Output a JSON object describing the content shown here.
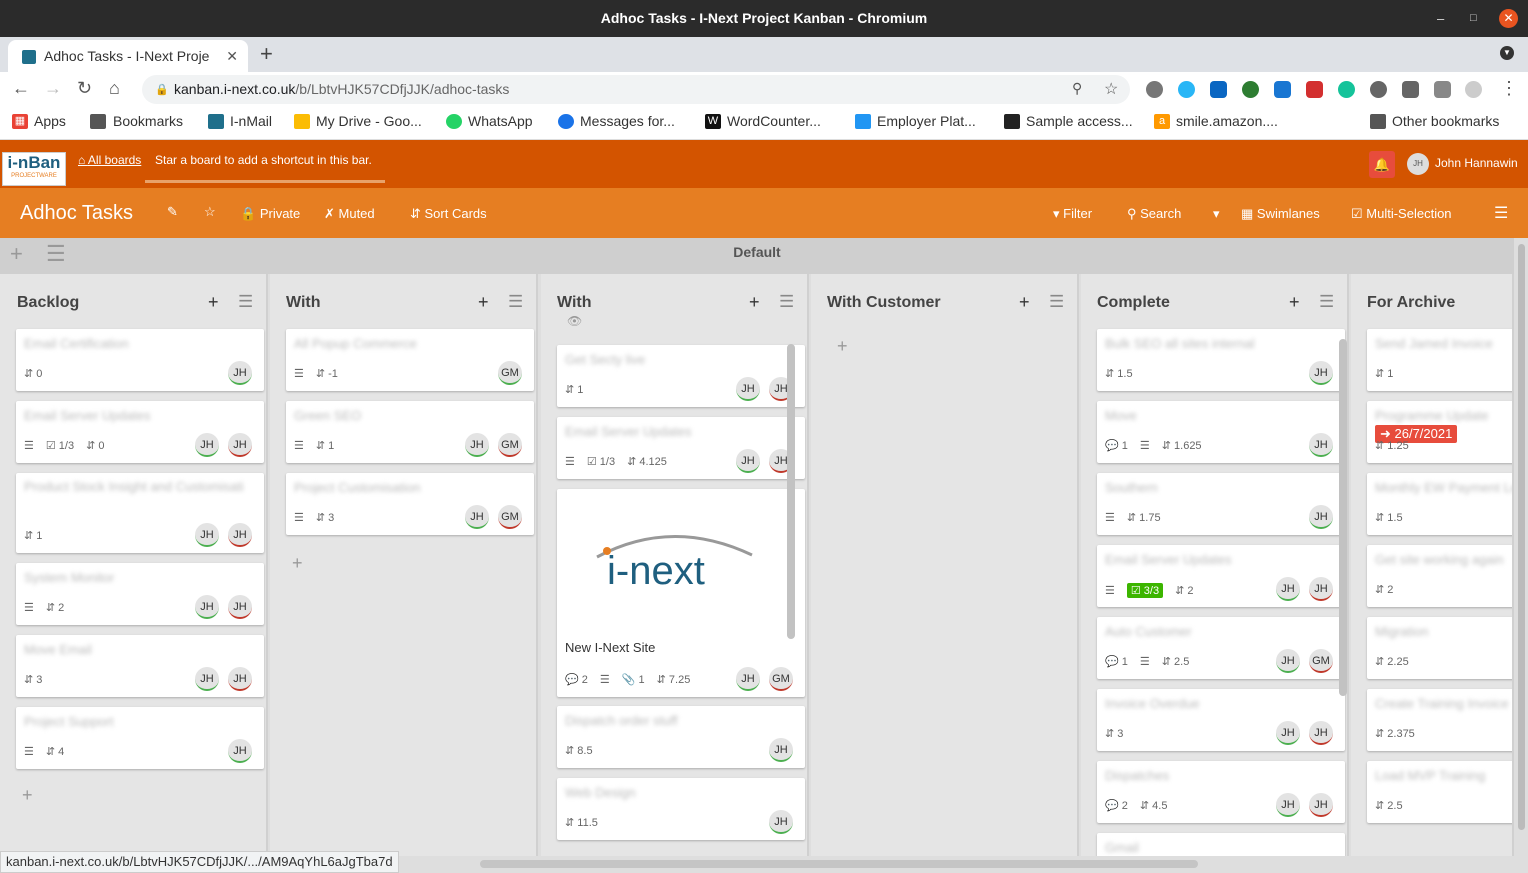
{
  "window": {
    "title": "Adhoc Tasks - I-Next Project Kanban - Chromium"
  },
  "browser": {
    "tab_title": "Adhoc Tasks - I-Next Proje",
    "url_host": "kanban.i-next.co.uk",
    "url_path": "/b/LbtvHJK57CDfjJJK/adhoc-tasks",
    "bookmarks": [
      "Apps",
      "Bookmarks",
      "I-nMail",
      "My Drive - Goo...",
      "WhatsApp",
      "Messages for...",
      "WordCounter...",
      "Employer Plat...",
      "Sample access...",
      "smile.amazon...."
    ],
    "other_bookmarks": "Other bookmarks",
    "status_url": "kanban.i-next.co.uk/b/LbtvHJK57CDfjJJK/.../AM9AqYhL6aJgTba7d"
  },
  "app": {
    "logo": "i-nBan",
    "logo_sub": "PROJECTWARE",
    "all_boards": "All boards",
    "star_hint": "Star a board to add a shortcut in this bar.",
    "user_initials": "JH",
    "user_name": "John Hannawin"
  },
  "board": {
    "title": "Adhoc Tasks",
    "private": "Private",
    "muted": "Muted",
    "sort": "Sort Cards",
    "filter": "Filter",
    "search": "Search",
    "swimlanes": "Swimlanes",
    "multi": "Multi-Selection",
    "swimlane": "Default"
  },
  "lists": [
    {
      "title": "Backlog",
      "cards": [
        {
          "title": "Email Certification",
          "badges": [
            "0"
          ]
        },
        {
          "title": "Email Server Updates",
          "badges": [
            "1/3",
            "0"
          ]
        },
        {
          "title": "Product Stock Insight and Customisation",
          "badges": [
            "1"
          ]
        },
        {
          "title": "System Monitor",
          "badges": [
            "2"
          ]
        },
        {
          "title": "Move Email",
          "badges": [
            "3"
          ]
        },
        {
          "title": "Project Support",
          "badges": [
            "4"
          ]
        }
      ]
    },
    {
      "title": "With",
      "cards": [
        {
          "title": "All Popup Commerce",
          "badges": [
            "-1"
          ]
        },
        {
          "title": "Green SEO",
          "badges": [
            "1"
          ]
        },
        {
          "title": "Project Customisation",
          "badges": [
            "3"
          ]
        }
      ]
    },
    {
      "title": "With",
      "cards": [
        {
          "title": "Get Secty live",
          "badges": [
            "1"
          ]
        },
        {
          "title": "Email Server Updates",
          "badges": [
            "1/3",
            "4.125"
          ]
        },
        {
          "title": "New I-Next Site",
          "cover": "i-next",
          "badges": [
            "2",
            "1",
            "7.25"
          ]
        },
        {
          "title": "Dispatch order stuff",
          "badges": [
            "8.5"
          ]
        },
        {
          "title": "Web Design",
          "badges": [
            "11.5"
          ]
        }
      ]
    },
    {
      "title": "With Customer",
      "cards": []
    },
    {
      "title": "Complete",
      "cards": [
        {
          "title": "Bulk SEO all sites internal",
          "badges": [
            "1.5"
          ]
        },
        {
          "title": "Move",
          "badges": [
            "1",
            "1.625"
          ]
        },
        {
          "title": "Southern",
          "badges": [
            "1.75"
          ]
        },
        {
          "title": "Email Server Updates",
          "badges": [
            "3/3",
            "2"
          ]
        },
        {
          "title": "Auto Customer",
          "badges": [
            "1",
            "2.5"
          ]
        },
        {
          "title": "Invoice Overdue",
          "badges": [
            "3"
          ]
        },
        {
          "title": "Dispatches",
          "badges": [
            "2",
            "4.5"
          ]
        },
        {
          "title": "Gmail",
          "badges": []
        }
      ]
    },
    {
      "title": "For Archive",
      "cards": [
        {
          "title": "Send Jamed Invoice",
          "badges": [
            "1"
          ]
        },
        {
          "title": "Programme Update",
          "date": "26/7/2021",
          "badges": [
            "1.25"
          ]
        },
        {
          "title": "Monthly EW Payment Lead",
          "badges": [
            "1.5"
          ]
        },
        {
          "title": "Get site working again",
          "badges": [
            "2"
          ]
        },
        {
          "title": "Migration",
          "badges": [
            "2.25"
          ]
        },
        {
          "title": "Create Training Invoice",
          "badges": [
            "2.375"
          ]
        },
        {
          "title": "Load MVP Training",
          "badges": [
            "2.5"
          ]
        }
      ]
    }
  ]
}
